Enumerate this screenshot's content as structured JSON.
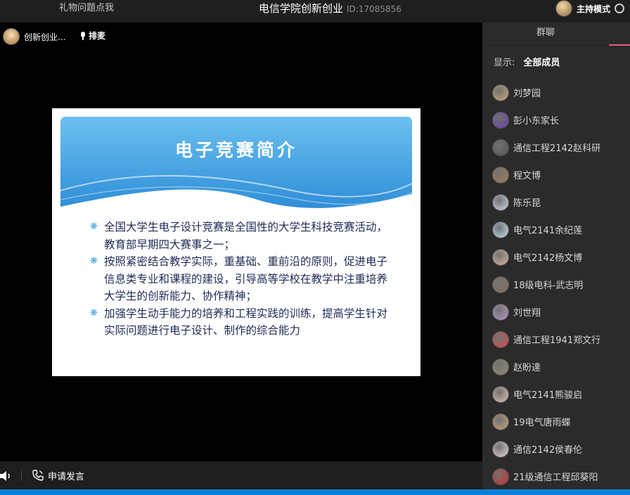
{
  "header": {
    "left_link": "礼物问题点我",
    "title": "电信学院创新创业",
    "room_id": "ID:17085856",
    "host_mode": "主持模式"
  },
  "stage": {
    "presenter_name": "创新创业...",
    "queue_label": "排麦"
  },
  "slide": {
    "title": "电子竞赛简介",
    "bullet_mark": "❋",
    "bullets": [
      "全国大学生电子设计竞赛是全国性的大学生科技竞赛活动，教育部早期四大赛事之一；",
      "按照紧密结合教学实际，重基础、重前沿的原则，促进电子信息类专业和课程的建设，引导高等学校在教学中注重培养大学生的创新能力、协作精神；",
      "加强学生动手能力的培养和工程实践的训练，提高学生针对实际问题进行电子设计、制作的综合能力"
    ]
  },
  "bottom": {
    "apply_speak": "申请发言"
  },
  "sidebar": {
    "tab_label": "群聊",
    "filter_label": "显示:",
    "filter_value": "全部成员",
    "members": [
      {
        "name": "刘梦园",
        "color": "#c9a978"
      },
      {
        "name": "彭小东家长",
        "color": "#6a3fb0"
      },
      {
        "name": "通信工程2142赵科研",
        "color": "#555555"
      },
      {
        "name": "程文博",
        "color": "#a87b4f"
      },
      {
        "name": "陈乐昆",
        "color": "#d0d8e8"
      },
      {
        "name": "电气2141余纪莲",
        "color": "#bfe3f2"
      },
      {
        "name": "电气2142杨文博",
        "color": "#d9b6a0"
      },
      {
        "name": "18级电科-武志明",
        "color": "#8a6e5a"
      },
      {
        "name": "刘世翔",
        "color": "#b39cc9"
      },
      {
        "name": "通信工程1941郑文行",
        "color": "#d84c4c"
      },
      {
        "name": "赵盼達",
        "color": "#9a8a70"
      },
      {
        "name": "电气2141熊骏启",
        "color": "#e0c2b0"
      },
      {
        "name": "19电气唐雨蝶",
        "color": "#c9a57a"
      },
      {
        "name": "通信2142侯春伦",
        "color": "#e8d0d8"
      },
      {
        "name": "21级通信工程邱葵阳",
        "color": "#d42a2a"
      }
    ]
  }
}
